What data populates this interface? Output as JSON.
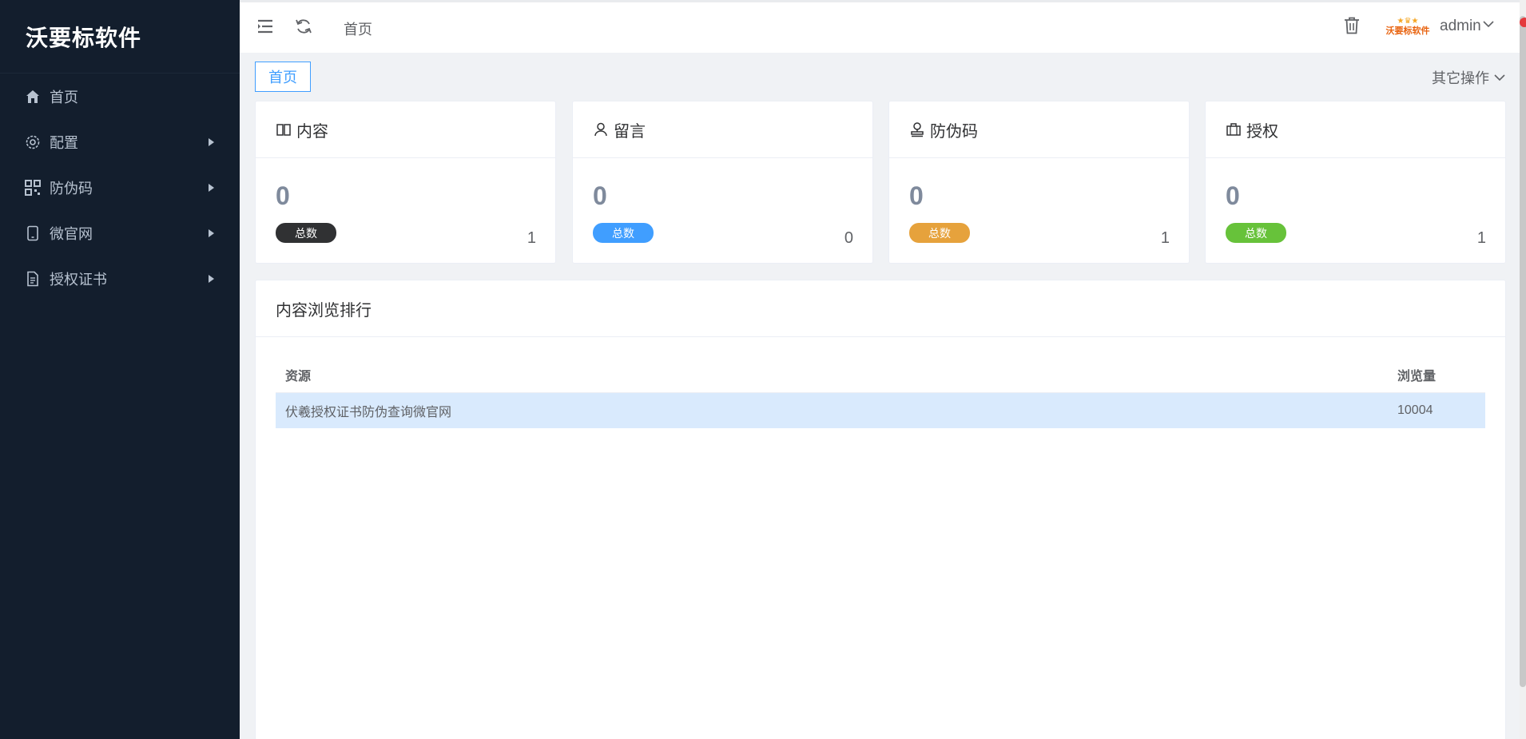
{
  "sidebar": {
    "brand": "沃要标软件",
    "items": [
      {
        "label": "首页",
        "icon": "home-icon",
        "has_children": false
      },
      {
        "label": "配置",
        "icon": "gear-icon",
        "has_children": true
      },
      {
        "label": "防伪码",
        "icon": "qrcode-icon",
        "has_children": true
      },
      {
        "label": "微官网",
        "icon": "mobile-icon",
        "has_children": true
      },
      {
        "label": "授权证书",
        "icon": "document-icon",
        "has_children": true
      }
    ]
  },
  "topbar": {
    "breadcrumb": "首页",
    "username": "admin",
    "avatar_text": "沃要标软件"
  },
  "tabs": {
    "active_label": "首页",
    "other_ops_label": "其它操作"
  },
  "stats": [
    {
      "title": "内容",
      "icon": "book-icon",
      "value": "0",
      "badge": "总数",
      "badge_color": "#303133",
      "count": "1"
    },
    {
      "title": "留言",
      "icon": "user-icon",
      "value": "0",
      "badge": "总数",
      "badge_color": "#409eff",
      "count": "0"
    },
    {
      "title": "防伪码",
      "icon": "stamp-icon",
      "value": "0",
      "badge": "总数",
      "badge_color": "#e6a23c",
      "count": "1"
    },
    {
      "title": "授权",
      "icon": "briefcase-icon",
      "value": "0",
      "badge": "总数",
      "badge_color": "#67c23a",
      "count": "1"
    }
  ],
  "ranking": {
    "title": "内容浏览排行",
    "col_resource": "资源",
    "col_views": "浏览量",
    "rows": [
      {
        "name": "伏羲授权证书防伪查询微官网",
        "views": "10004"
      }
    ]
  },
  "colors": {
    "sidebar_bg": "#131e2d",
    "accent": "#409eff",
    "highlight_row": "#d9eafd"
  }
}
